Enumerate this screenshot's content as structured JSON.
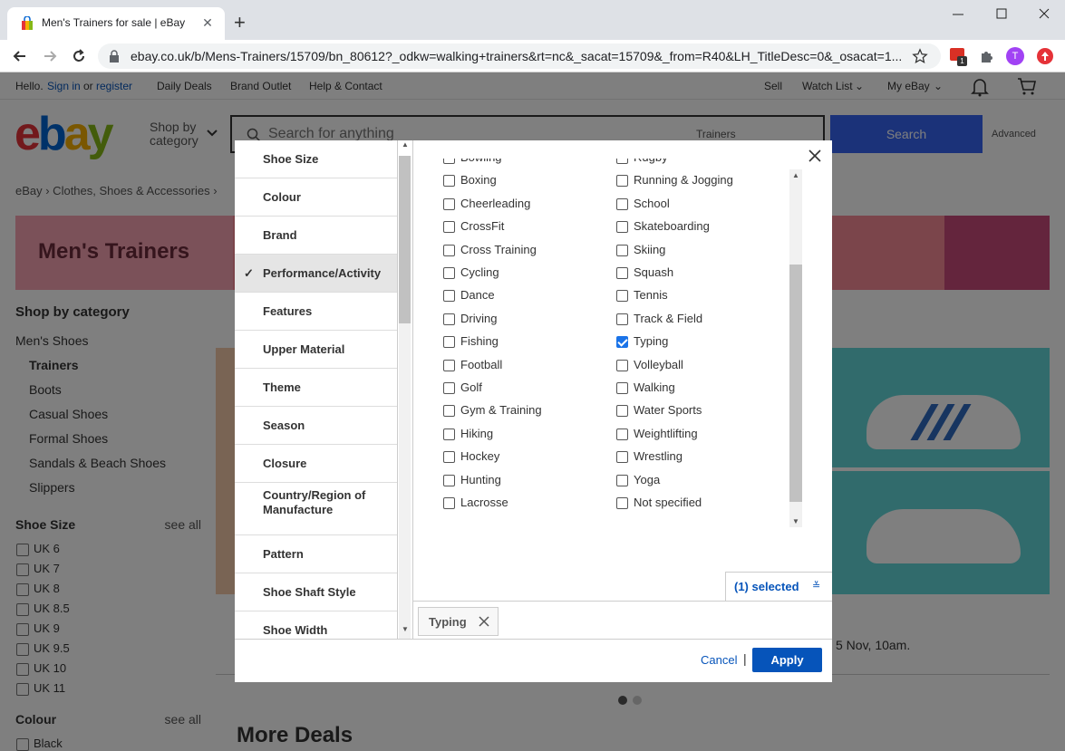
{
  "browser": {
    "tab_title": "Men's Trainers for sale | eBay",
    "url": "ebay.co.uk/b/Mens-Trainers/15709/bn_80612?_odkw=walking+trainers&rt=nc&_sacat=15709&_from=R40&LH_TitleDesc=0&_osacat=1...",
    "ext_badge": "1",
    "profile_initial": "T"
  },
  "topnav": {
    "hello": "Hello.",
    "sign_in": "Sign in",
    "or": "or",
    "register": "register",
    "daily_deals": "Daily Deals",
    "brand_outlet": "Brand Outlet",
    "help": "Help & Contact",
    "sell": "Sell",
    "watch_list": "Watch List",
    "my_ebay": "My eBay"
  },
  "header": {
    "logo": [
      "e",
      "b",
      "a",
      "y"
    ],
    "shop_by_1": "Shop by",
    "shop_by_2": "category",
    "search_placeholder": "Search for anything",
    "search_category": "Trainers",
    "search_button": "Search",
    "advanced": "Advanced"
  },
  "breadcrumb": "eBay  ›  Clothes, Shoes & Accessories  ›",
  "banner_title": "Men's Trainers",
  "sidebar": {
    "heading": "Shop by category",
    "items": [
      {
        "label": "Men's Shoes",
        "level": 0
      },
      {
        "label": "Trainers",
        "level": 1,
        "bold": true
      },
      {
        "label": "Boots",
        "level": 1
      },
      {
        "label": "Casual Shoes",
        "level": 1
      },
      {
        "label": "Formal Shoes",
        "level": 1
      },
      {
        "label": "Sandals & Beach Shoes",
        "level": 1
      },
      {
        "label": "Slippers",
        "level": 1
      }
    ],
    "shoe_size": {
      "heading": "Shoe Size",
      "see_all": "see all",
      "items": [
        "UK 6",
        "UK 7",
        "UK 8",
        "UK 8.5",
        "UK 9",
        "UK 9.5",
        "UK 10",
        "UK 11"
      ]
    },
    "colour": {
      "heading": "Colour",
      "see_all": "see all",
      "items": [
        "Black"
      ]
    }
  },
  "promo_end_text": "5 Nov, 10am.",
  "more_deals": "More Deals",
  "modal": {
    "categories": [
      {
        "label": "Shoe Size"
      },
      {
        "label": "Colour"
      },
      {
        "label": "Brand"
      },
      {
        "label": "Performance/Activity",
        "active": true
      },
      {
        "label": "Features"
      },
      {
        "label": "Upper Material"
      },
      {
        "label": "Theme"
      },
      {
        "label": "Season"
      },
      {
        "label": "Closure"
      },
      {
        "label": "Country/Region of Manufacture"
      },
      {
        "label": "Pattern"
      },
      {
        "label": "Shoe Shaft Style"
      },
      {
        "label": "Shoe Width"
      }
    ],
    "options_col1": [
      "Bowling",
      "Boxing",
      "Cheerleading",
      "CrossFit",
      "Cross Training",
      "Cycling",
      "Dance",
      "Driving",
      "Fishing",
      "Football",
      "Golf",
      "Gym & Training",
      "Hiking",
      "Hockey",
      "Hunting",
      "Lacrosse"
    ],
    "options_col2": [
      "Rugby",
      "Running & Jogging",
      "School",
      "Skateboarding",
      "Skiing",
      "Squash",
      "Tennis",
      "Track & Field",
      "Typing",
      "Volleyball",
      "Walking",
      "Water Sports",
      "Weightlifting",
      "Wrestling",
      "Yoga",
      "Not specified"
    ],
    "checked": [
      "Typing"
    ],
    "selected_count": "(1) selected",
    "chip_label": "Typing",
    "cancel": "Cancel",
    "separator": "|",
    "apply": "Apply"
  },
  "colors": {
    "accent": "#0654ba",
    "search": "#3665f3",
    "checkbox": "#1a73e8"
  }
}
